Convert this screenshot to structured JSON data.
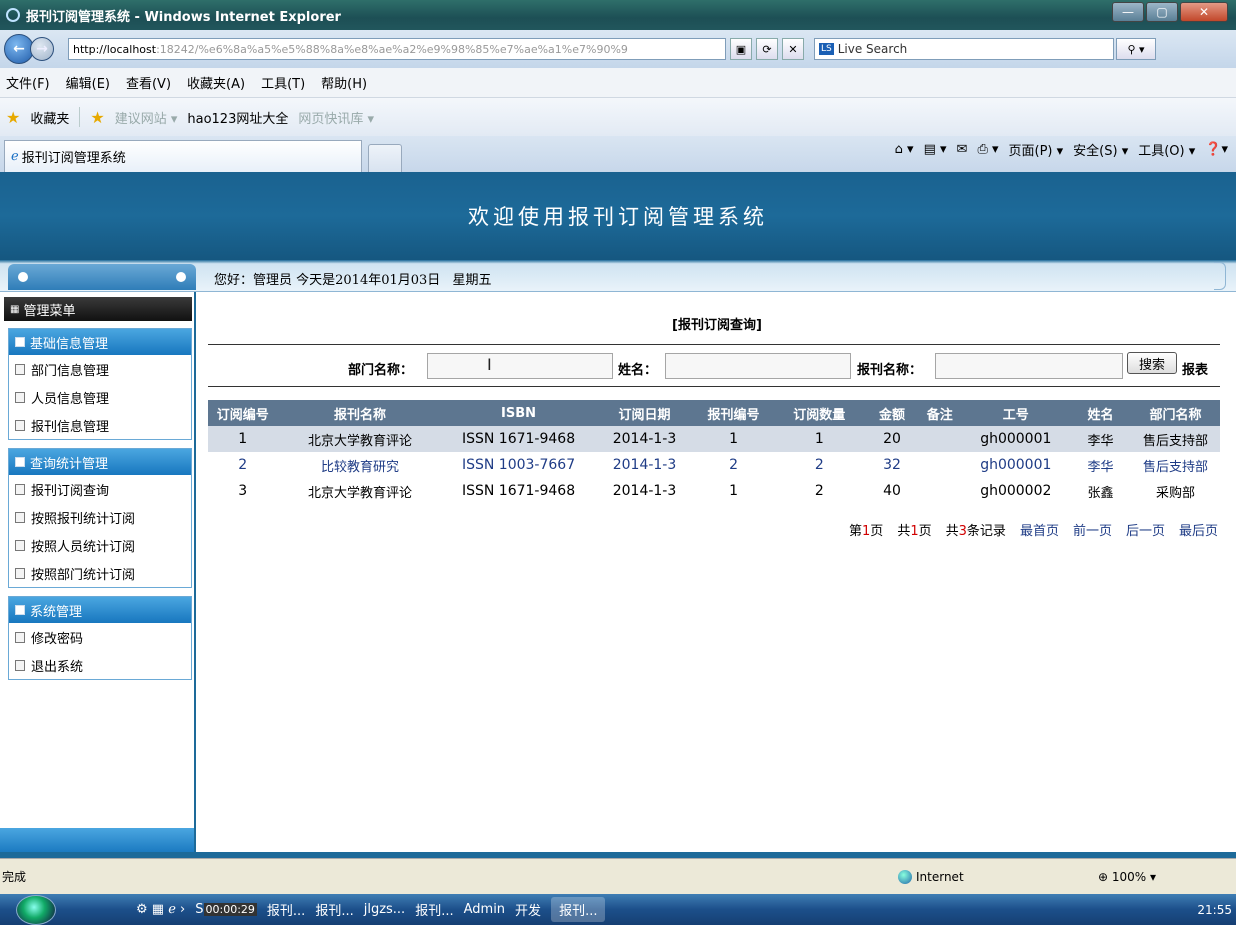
{
  "browser": {
    "title": "报刊订阅管理系统 - Windows Internet Explorer",
    "address_host": "http://localhost",
    "address_rest": ":18242/%e6%8a%a5%e5%88%8a%e8%ae%a2%e9%98%85%e7%ae%a1%e7%90%9",
    "search_placeholder": "Live Search",
    "search_logo": "LS",
    "menus": [
      "文件(F)",
      "编辑(E)",
      "查看(V)",
      "收藏夹(A)",
      "工具(T)",
      "帮助(H)"
    ],
    "favorites_label": "收藏夹",
    "fav_links": [
      "建议网站 ▾",
      "hao123网址大全",
      "网页快讯库 ▾"
    ],
    "tab_title": "报刊订阅管理系统",
    "cmd": [
      "页面(P) ▾",
      "安全(S) ▾",
      "工具(O) ▾"
    ],
    "status_done": "完成",
    "status_zone": "Internet",
    "zoom": "100%"
  },
  "page": {
    "header_title": "欢迎使用报刊订阅管理系统",
    "greeting_text": "您好：管理员   今天是",
    "greeting_date": "2014年01月03日",
    "greeting_weekday": "星期五"
  },
  "sidebar": {
    "menu_title": "管理菜单",
    "groups": [
      {
        "title": "基础信息管理",
        "items": [
          "部门信息管理",
          "人员信息管理",
          "报刊信息管理"
        ]
      },
      {
        "title": "查询统计管理",
        "items": [
          "报刊订阅查询",
          "按照报刊统计订阅",
          "按照人员统计订阅",
          "按照部门统计订阅"
        ]
      },
      {
        "title": "系统管理",
        "items": [
          "修改密码",
          "退出系统"
        ]
      }
    ]
  },
  "query": {
    "title": "[报刊订阅查询]",
    "dept_label": "部门名称：",
    "name_label": "姓名：",
    "paper_label": "报刊名称：",
    "search_button": "搜索",
    "report_link": "报表",
    "columns": [
      "订阅编号",
      "报刊名称",
      "ISBN",
      "订阅日期",
      "报刊编号",
      "订阅数量",
      "金额",
      "备注",
      "工号",
      "姓名",
      "部门名称"
    ],
    "rows": [
      [
        "1",
        "北京大学教育评论",
        "ISSN 1671-9468",
        "2014-1-3",
        "1",
        "1",
        "20",
        "",
        "gh000001",
        "李华",
        "售后支持部"
      ],
      [
        "2",
        "比较教育研究",
        "ISSN 1003-7667",
        "2014-1-3",
        "2",
        "2",
        "32",
        "",
        "gh000001",
        "李华",
        "售后支持部"
      ],
      [
        "3",
        "北京大学教育评论",
        "ISSN 1671-9468",
        "2014-1-3",
        "1",
        "2",
        "40",
        "",
        "gh000002",
        "张鑫",
        "采购部"
      ]
    ],
    "pager": {
      "page_prefix": "第",
      "page_num": "1",
      "page_suffix": "页",
      "total_prefix": "共",
      "total_pages": "1",
      "total_suffix": "页",
      "rec_prefix": "共",
      "records": "3",
      "rec_suffix": "条记录",
      "first": "最首页",
      "prev": "前一页",
      "next": "后一页",
      "last": "最后页"
    }
  },
  "taskbar": {
    "timer": "00:00:29",
    "items": [
      "报刊...",
      "报刊...",
      "jlgzs...",
      "报刊...",
      "Admin",
      "开发"
    ],
    "active": "报刊...",
    "clock": "21:55"
  },
  "colors": {
    "header_blue": "#1d6a99",
    "table_header": "#5d7690",
    "link_blue": "#1f3c86",
    "pager_red": "#d00000"
  }
}
